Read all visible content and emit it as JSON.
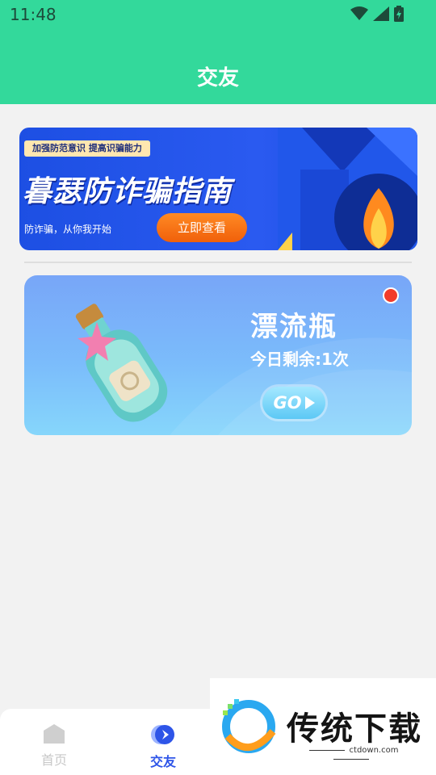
{
  "status_bar": {
    "time": "11:48"
  },
  "header": {
    "title": "交友"
  },
  "banner_anti_fraud": {
    "tag": "加强防范意识 提高识骗能力",
    "headline": "暮瑟防诈骗指南",
    "subtitle": "防诈骗，从你我开始",
    "button_label": "立即查看"
  },
  "banner_bottle": {
    "title": "漂流瓶",
    "remaining": "今日剩余:1次",
    "go_label": "GO"
  },
  "bottom_nav": {
    "items": [
      {
        "label": "首页",
        "icon": "home-icon",
        "active": false
      },
      {
        "label": "交友",
        "icon": "compass-icon",
        "active": true
      }
    ]
  },
  "watermark": {
    "brand": "传统下载",
    "url": "ctdown.com"
  },
  "colors": {
    "header": "#33d99b",
    "active_nav": "#2e55e8",
    "banner_blue": "#1d4fe3",
    "cta_orange": "#f0600a"
  }
}
